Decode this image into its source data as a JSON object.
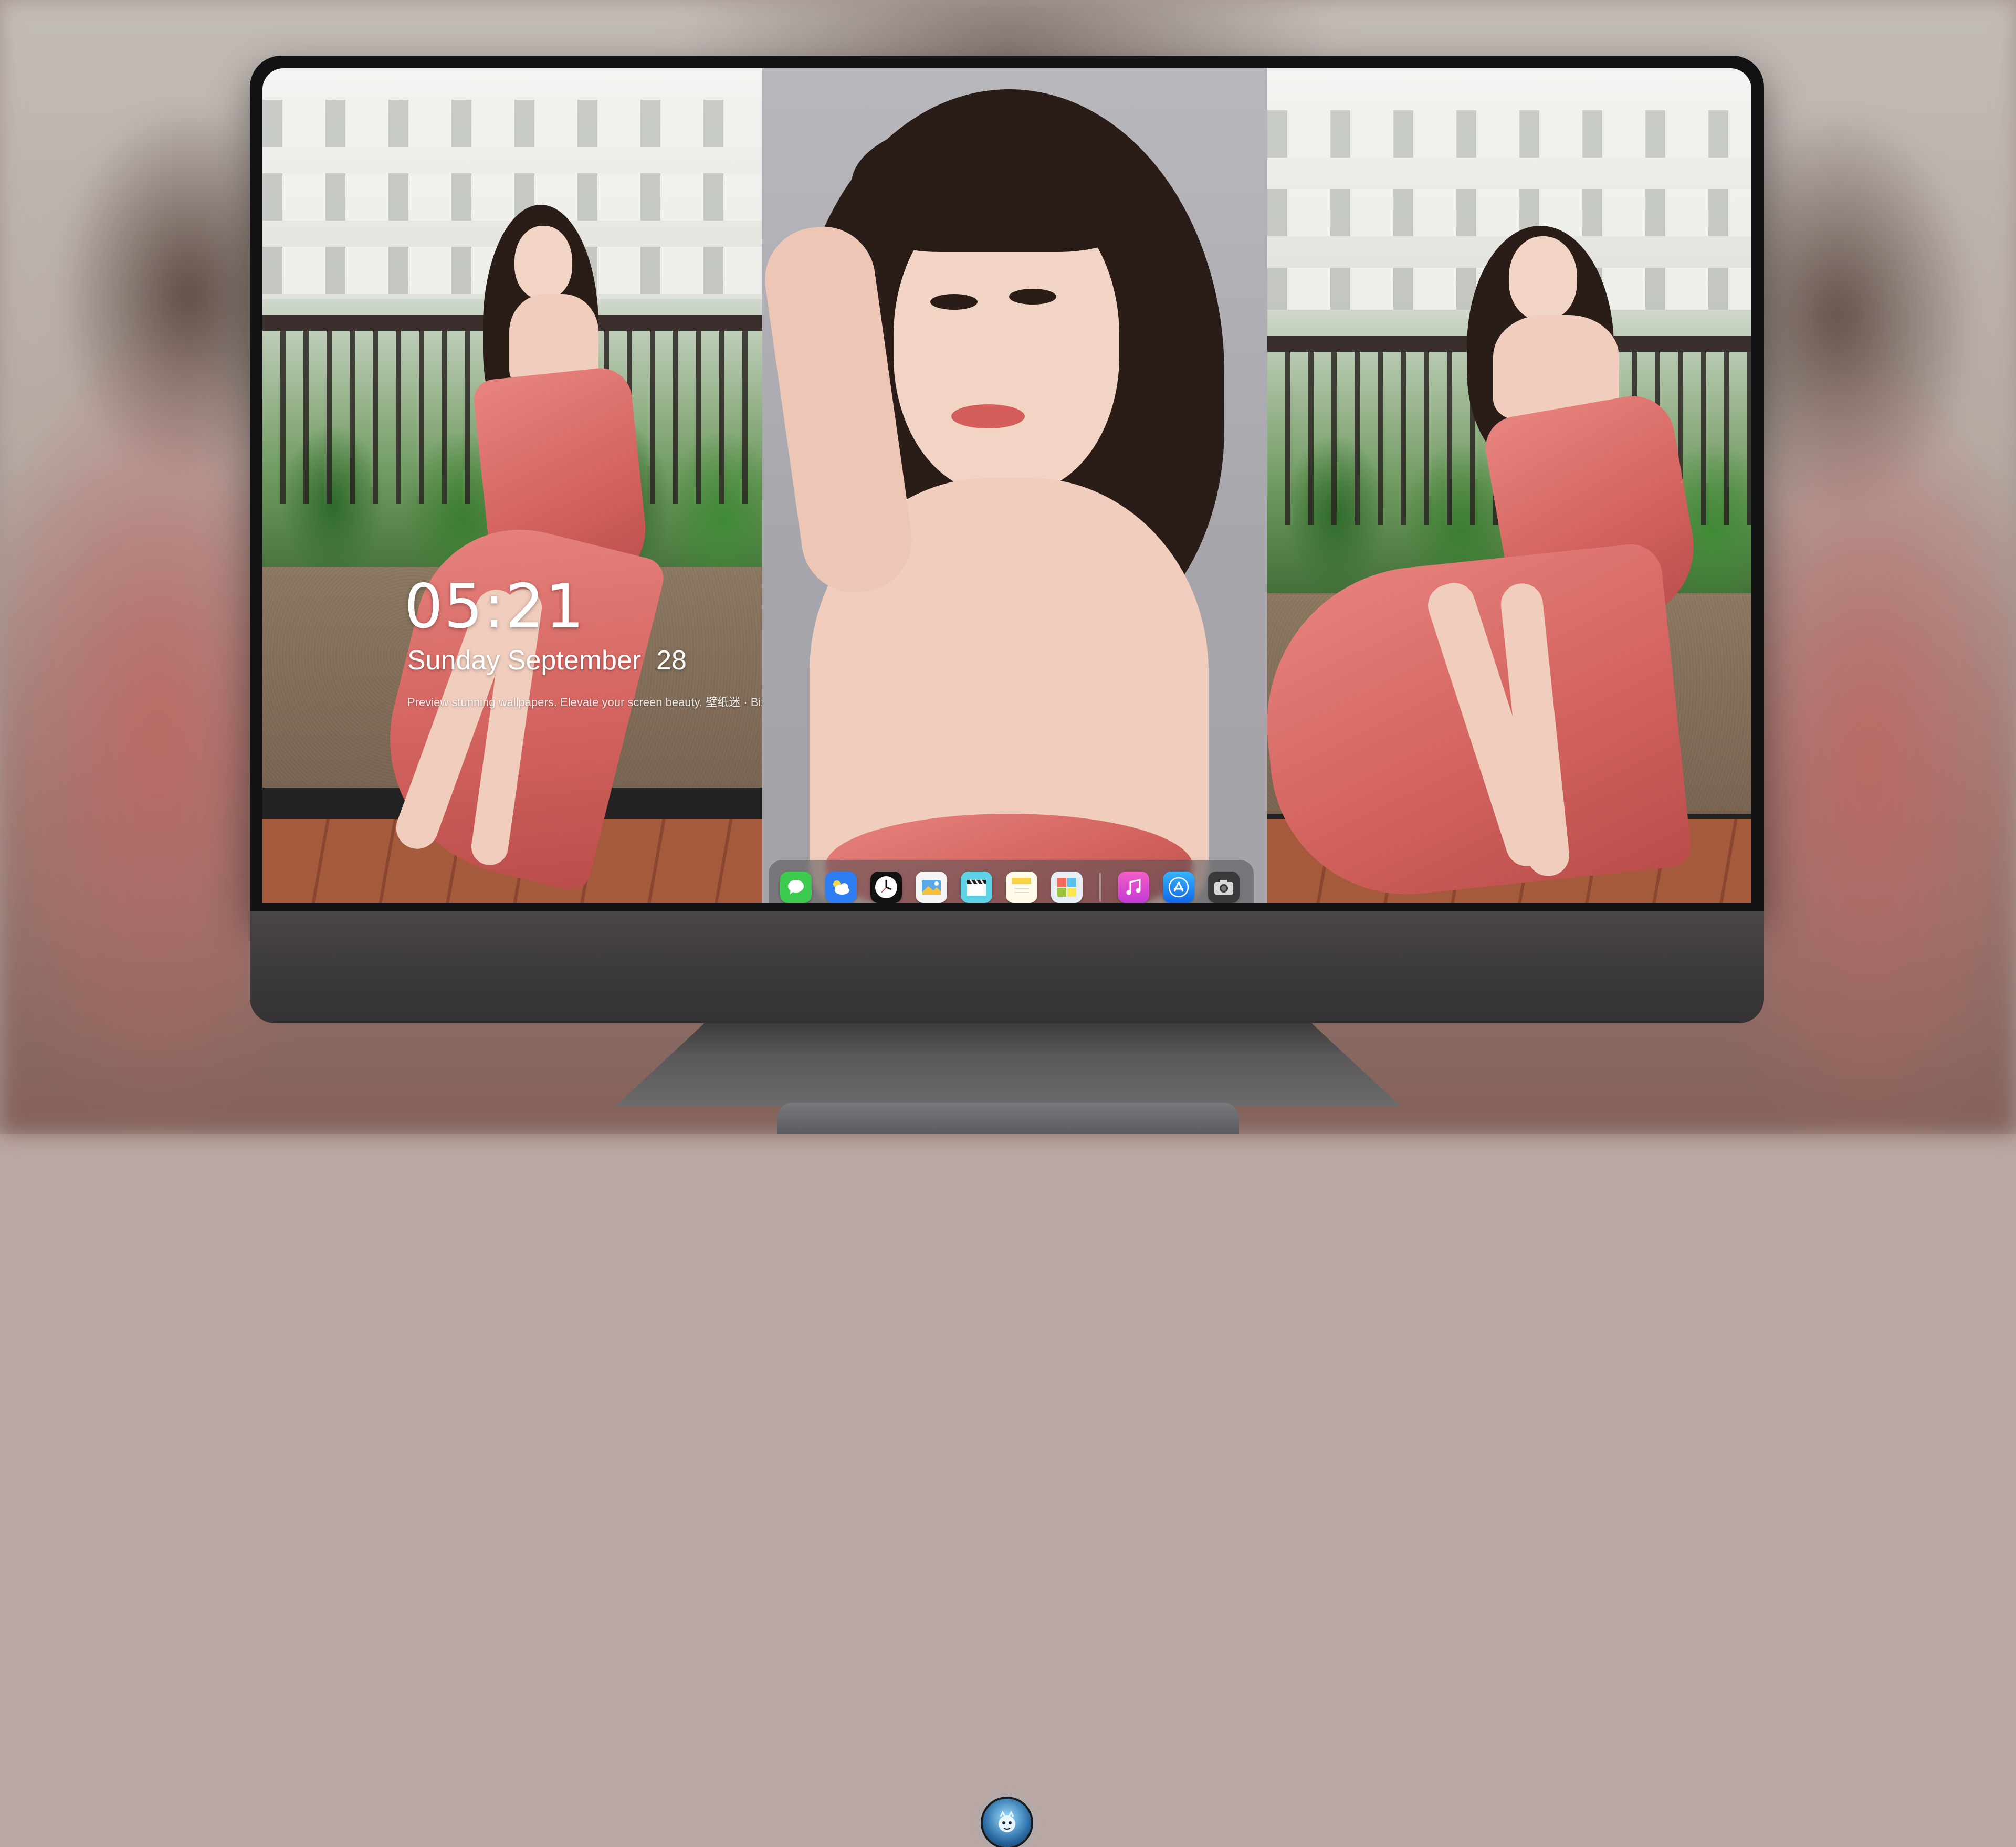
{
  "lockscreen": {
    "time": "05:21",
    "date": "Sunday September  28",
    "tagline": "Preview stunning wallpapers. Elevate your screen beauty. 壁纸迷 · Bizhimi.CN"
  },
  "dock": {
    "apps": [
      {
        "name": "messages",
        "icon": "speech-bubble-icon",
        "color": "#3ccb4e"
      },
      {
        "name": "weather",
        "icon": "cloud-icon",
        "color": "#2f7df2"
      },
      {
        "name": "clock",
        "icon": "clock-icon",
        "color": "#111111"
      },
      {
        "name": "preview",
        "icon": "photo-viewer-icon",
        "color": "#f5f5f5"
      },
      {
        "name": "clips",
        "icon": "clapperboard-icon",
        "color": "#5fd2e6"
      },
      {
        "name": "notes",
        "icon": "notepad-icon",
        "color": "#f7d44a"
      },
      {
        "name": "photo-booth",
        "icon": "photo-grid-icon",
        "color": "#e9eef4"
      },
      {
        "name": "music",
        "icon": "music-note-icon",
        "color": "#e14bd8"
      },
      {
        "name": "app-store",
        "icon": "app-store-icon",
        "color": "#1f8cf7"
      },
      {
        "name": "camera",
        "icon": "camera-icon",
        "color": "#3a3a3c"
      }
    ]
  },
  "monitor": {
    "brand_logo": "dragon-mascot-logo-icon"
  },
  "colors": {
    "dress": "#d9645f",
    "bezel": "#121214",
    "chin": "#3b3839"
  }
}
